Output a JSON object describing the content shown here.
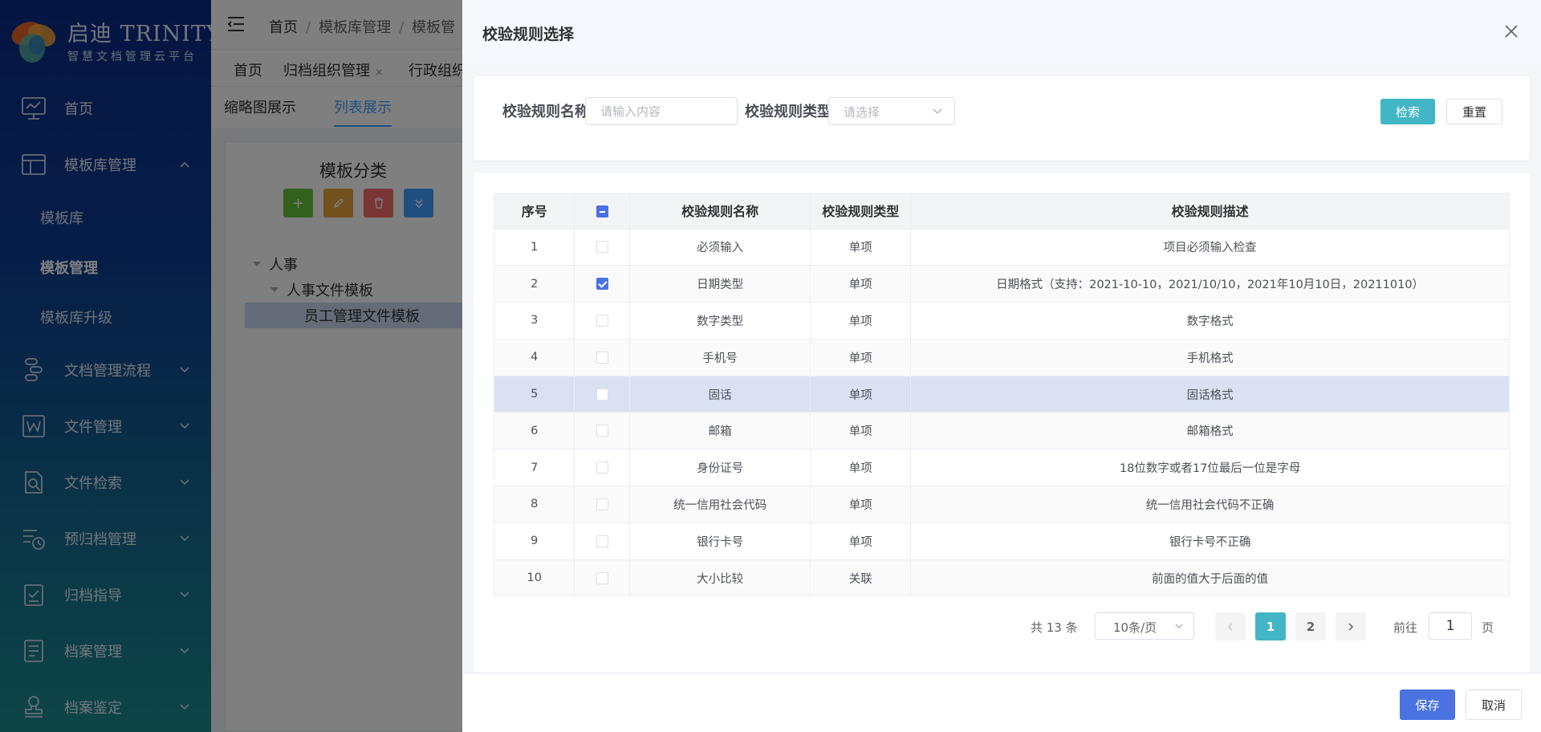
{
  "brand": {
    "title": "启迪 TRINITY",
    "subtitle": "智慧文档管理云平台"
  },
  "sidebar": {
    "items": [
      {
        "label": "首页",
        "icon": "monitor-icon"
      },
      {
        "label": "模板库管理",
        "icon": "layout-icon",
        "expanded": true,
        "children": [
          {
            "label": "模板库"
          },
          {
            "label": "模板管理",
            "active": true
          },
          {
            "label": "模板库升级"
          }
        ]
      },
      {
        "label": "文档管理流程",
        "icon": "flow-icon"
      },
      {
        "label": "文件管理",
        "icon": "word-icon"
      },
      {
        "label": "文件检索",
        "icon": "doc-search-icon"
      },
      {
        "label": "预归档管理",
        "icon": "pre-archive-icon"
      },
      {
        "label": "归档指导",
        "icon": "checklist-icon"
      },
      {
        "label": "档案管理",
        "icon": "archive-icon"
      },
      {
        "label": "档案鉴定",
        "icon": "stamp-icon"
      }
    ]
  },
  "breadcrumb": [
    "首页",
    "模板库管理",
    "模板管"
  ],
  "tags": [
    {
      "label": "首页"
    },
    {
      "label": "归档组织管理",
      "closable": true
    },
    {
      "label": "行政组织"
    }
  ],
  "view_tabs": [
    "缩略图展示",
    "列表展示"
  ],
  "panel": {
    "title": "模板分类",
    "tree": [
      "人事",
      "人事文件模板",
      "员工管理文件模板"
    ]
  },
  "drawer": {
    "title": "校验规则选择",
    "search": {
      "name_label": "校验规则名称:",
      "name_placeholder": "请输入内容",
      "type_label": "校验规则类型:",
      "type_placeholder": "请选择",
      "search_btn": "检索",
      "reset_btn": "重置"
    },
    "table": {
      "headers": [
        "序号",
        "",
        "校验规则名称",
        "校验规则类型",
        "校验规则描述"
      ],
      "rows": [
        {
          "no": "1",
          "checked": false,
          "name": "必须输入",
          "type": "单项",
          "desc": "项目必须输入检查"
        },
        {
          "no": "2",
          "checked": true,
          "name": "日期类型",
          "type": "单项",
          "desc": "日期格式（支持：2021-10-10，2021/10/10，2021年10月10日，20211010）"
        },
        {
          "no": "3",
          "checked": false,
          "name": "数字类型",
          "type": "单项",
          "desc": "数字格式"
        },
        {
          "no": "4",
          "checked": false,
          "name": "手机号",
          "type": "单项",
          "desc": "手机格式"
        },
        {
          "no": "5",
          "checked": false,
          "name": "固话",
          "type": "单项",
          "desc": "固话格式"
        },
        {
          "no": "6",
          "checked": false,
          "name": "邮箱",
          "type": "单项",
          "desc": "邮箱格式"
        },
        {
          "no": "7",
          "checked": false,
          "name": "身份证号",
          "type": "单项",
          "desc": "18位数字或者17位最后一位是字母"
        },
        {
          "no": "8",
          "checked": false,
          "name": "统一信用社会代码",
          "type": "单项",
          "desc": "统一信用社会代码不正确"
        },
        {
          "no": "9",
          "checked": false,
          "name": "银行卡号",
          "type": "单项",
          "desc": "银行卡号不正确"
        },
        {
          "no": "10",
          "checked": false,
          "name": "大小比较",
          "type": "关联",
          "desc": "前面的值大于后面的值"
        }
      ]
    },
    "pagination": {
      "total": "共 13 条",
      "page_size": "10条/页",
      "pages": [
        "1",
        "2"
      ],
      "current": "1",
      "goto_label": "前往",
      "goto_value": "1",
      "goto_unit": "页"
    },
    "footer": {
      "save": "保存",
      "cancel": "取消"
    }
  },
  "colors": {
    "primary": "#4a72e0",
    "teal": "#42b6c5",
    "highlight_row": "#d9e1f2"
  }
}
